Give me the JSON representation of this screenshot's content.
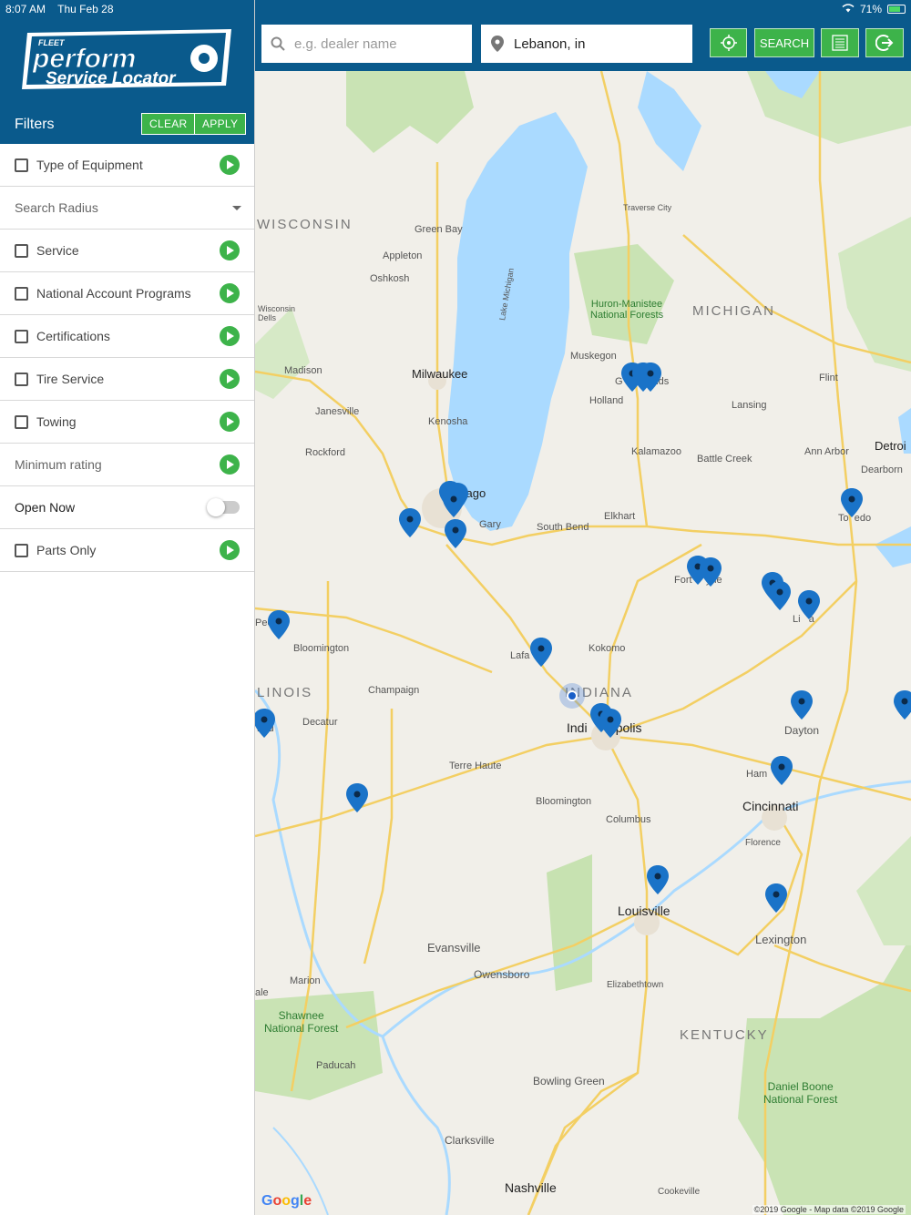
{
  "status_bar": {
    "time": "8:07 AM",
    "date": "Thu Feb 28",
    "battery": "71%"
  },
  "app": {
    "logo_top": "FLEET",
    "logo_main": "perform",
    "logo_sub": "Service Locator"
  },
  "sidebar": {
    "title": "Filters",
    "clear_label": "CLEAR",
    "apply_label": "APPLY",
    "filters": [
      {
        "label": "Type of Equipment"
      },
      {
        "label": "Search Radius"
      },
      {
        "label": "Service"
      },
      {
        "label": "National Account Programs"
      },
      {
        "label": "Certifications"
      },
      {
        "label": "Tire Service"
      },
      {
        "label": "Towing"
      },
      {
        "label": "Minimum rating"
      },
      {
        "label": "Open Now"
      },
      {
        "label": "Parts Only"
      }
    ]
  },
  "topbar": {
    "dealer_placeholder": "e.g. dealer name",
    "location_value": "Lebanon, in",
    "search_label": "SEARCH"
  },
  "map": {
    "labels": {
      "wisconsin": "WISCONSIN",
      "michigan": "MICHIGAN",
      "indiana": "INDIANA",
      "illinois": "LINOIS",
      "kentucky": "KENTUCKY",
      "green_bay": "Green Bay",
      "appleton": "Appleton",
      "oshkosh": "Oshkosh",
      "madison": "Madison",
      "milwaukee": "Milwaukee",
      "janesville": "Janesville",
      "kenosha": "Kenosha",
      "rockford": "Rockford",
      "chicago": "cago",
      "gary": "Gary",
      "south_bend": "South Bend",
      "elkhart": "Elkhart",
      "kalamazoo": "Kalamazoo",
      "battle_creek": "Battle Creek",
      "lansing": "Lansing",
      "flint": "Flint",
      "ann_arbor": "Ann Arbor",
      "detroit": "Detroi",
      "dearborn": "Dearborn",
      "toledo": "To  edo",
      "holland": "Holland",
      "muskegon": "Muskegon",
      "grand_rapids": "G        apids",
      "traverse_city": "Traverse City",
      "huron": "Huron-Manistee\nNational Forests",
      "fort_wayne": "Fort     yne",
      "lima": "Li   a",
      "kokomo": "Kokomo",
      "lafayette": "Lafa     e",
      "indianapolis": "Indi        polis",
      "bloomington_il": "Bloomington",
      "champaign": "Champaign",
      "decatur": "Decatur",
      "springfield": "ield",
      "peoria": "Peo",
      "terre_haute": "Terre Haute",
      "bloomington_in": "Bloomington",
      "columbus": "Columbus",
      "dayton": "Dayton",
      "hamilton": "Ham",
      "cincinnati": "Cincinnati",
      "florence": "Florence",
      "louisville": "Louisville",
      "lexington": "Lexington",
      "evansville": "Evansville",
      "owensboro": "Owensboro",
      "elizabethtown": "Elizabethtown",
      "marion": "Marion",
      "shawnee": "Shawnee\nNational Forest",
      "paducah": "Paducah",
      "bowling_green": "Bowling Green",
      "daniel_boone": "Daniel Boone\nNational Forest",
      "clarksville": "Clarksville",
      "nashville": "Nashville",
      "cookeville": "Cookeville",
      "lake_michigan": "Lake Michigan",
      "wisconsin_dells": "Wisconsin\nDells",
      "ale": "ale"
    },
    "google": "Google",
    "credit": "©2019 Google - Map data ©2019 Google"
  },
  "colors": {
    "header": "#0a5a8c",
    "accent": "#3db34a",
    "pin": "#1a73c8"
  }
}
